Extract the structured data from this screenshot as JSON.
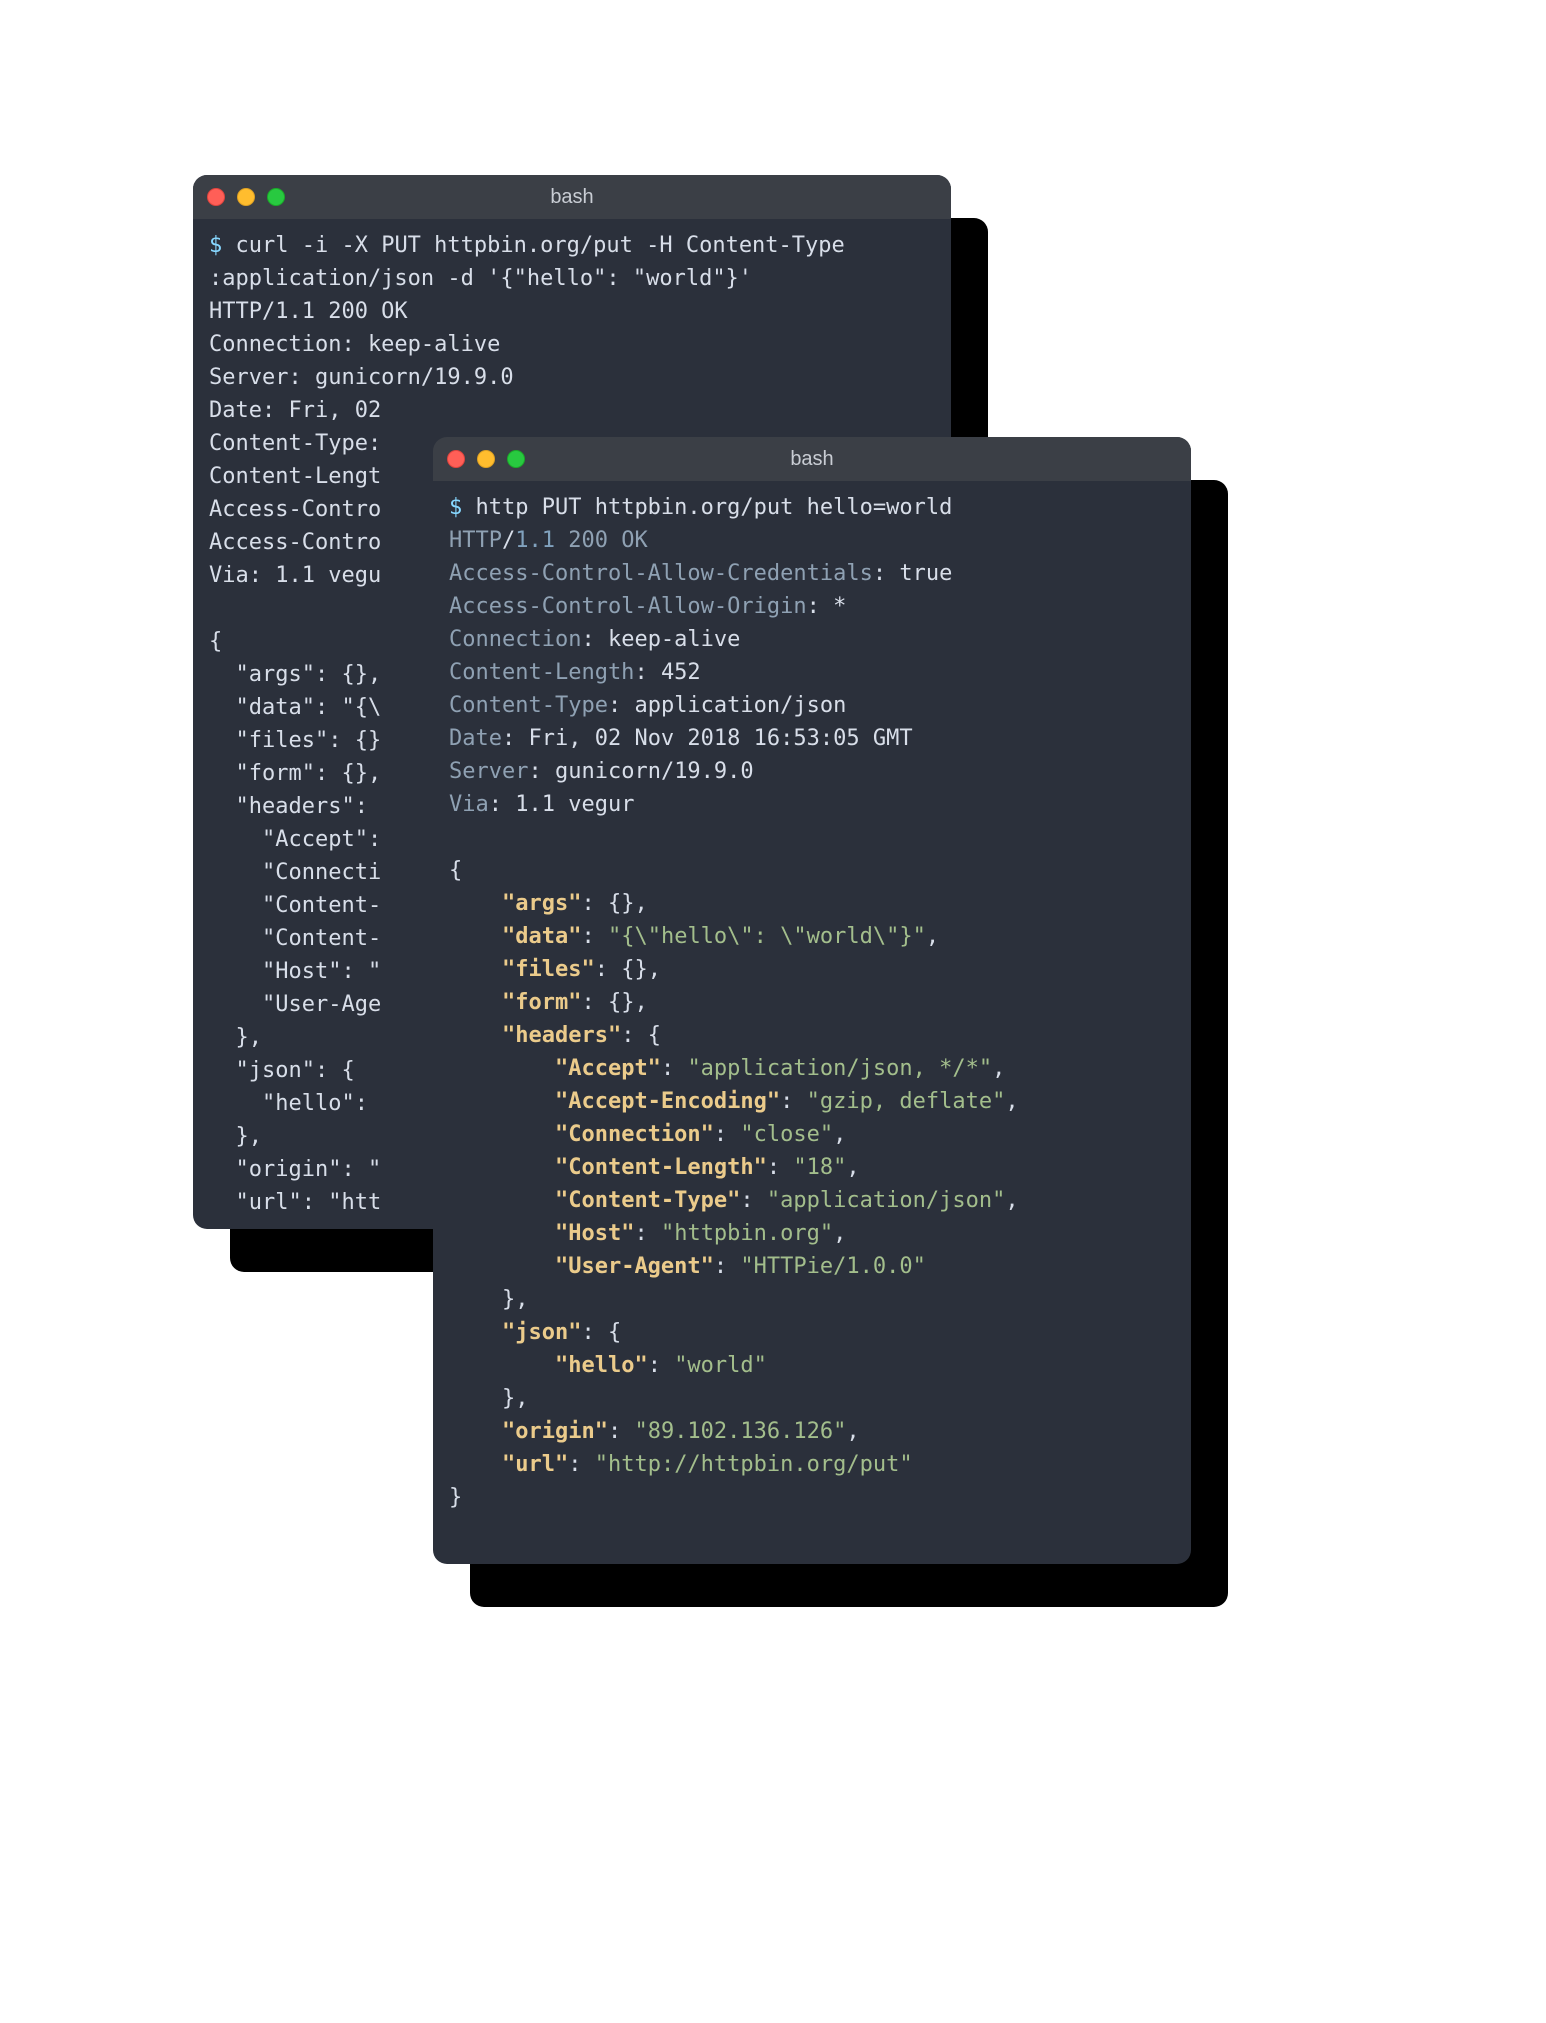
{
  "windows": {
    "back": {
      "title": "bash",
      "lines": [
        {
          "seg": [
            {
              "c": "prompt",
              "t": "$ "
            },
            {
              "c": "text",
              "t": "curl -i -X PUT httpbin.org/put -H Content-Type"
            }
          ]
        },
        {
          "seg": [
            {
              "c": "text",
              "t": ":application/json -d '{\"hello\": \"world\"}'"
            }
          ]
        },
        {
          "seg": [
            {
              "c": "text",
              "t": "HTTP/1.1 200 OK"
            }
          ]
        },
        {
          "seg": [
            {
              "c": "text",
              "t": "Connection: keep-alive"
            }
          ]
        },
        {
          "seg": [
            {
              "c": "text",
              "t": "Server: gunicorn/19.9.0"
            }
          ]
        },
        {
          "seg": [
            {
              "c": "text",
              "t": "Date: Fri, 02"
            }
          ]
        },
        {
          "seg": [
            {
              "c": "text",
              "t": "Content-Type:"
            }
          ]
        },
        {
          "seg": [
            {
              "c": "text",
              "t": "Content-Lengt"
            }
          ]
        },
        {
          "seg": [
            {
              "c": "text",
              "t": "Access-Contro"
            }
          ]
        },
        {
          "seg": [
            {
              "c": "text",
              "t": "Access-Contro"
            }
          ]
        },
        {
          "seg": [
            {
              "c": "text",
              "t": "Via: 1.1 vegu"
            }
          ]
        },
        {
          "seg": [
            {
              "c": "text",
              "t": ""
            }
          ]
        },
        {
          "seg": [
            {
              "c": "text",
              "t": "{"
            }
          ]
        },
        {
          "seg": [
            {
              "c": "text",
              "t": "  \"args\": {},"
            }
          ]
        },
        {
          "seg": [
            {
              "c": "text",
              "t": "  \"data\": \"{\\"
            }
          ]
        },
        {
          "seg": [
            {
              "c": "text",
              "t": "  \"files\": {}"
            }
          ]
        },
        {
          "seg": [
            {
              "c": "text",
              "t": "  \"form\": {},"
            }
          ]
        },
        {
          "seg": [
            {
              "c": "text",
              "t": "  \"headers\":"
            }
          ]
        },
        {
          "seg": [
            {
              "c": "text",
              "t": "    \"Accept\":"
            }
          ]
        },
        {
          "seg": [
            {
              "c": "text",
              "t": "    \"Connecti"
            }
          ]
        },
        {
          "seg": [
            {
              "c": "text",
              "t": "    \"Content-"
            }
          ]
        },
        {
          "seg": [
            {
              "c": "text",
              "t": "    \"Content-"
            }
          ]
        },
        {
          "seg": [
            {
              "c": "text",
              "t": "    \"Host\": \""
            }
          ]
        },
        {
          "seg": [
            {
              "c": "text",
              "t": "    \"User-Age"
            }
          ]
        },
        {
          "seg": [
            {
              "c": "text",
              "t": "  },"
            }
          ]
        },
        {
          "seg": [
            {
              "c": "text",
              "t": "  \"json\": {"
            }
          ]
        },
        {
          "seg": [
            {
              "c": "text",
              "t": "    \"hello\": "
            }
          ]
        },
        {
          "seg": [
            {
              "c": "text",
              "t": "  },"
            }
          ]
        },
        {
          "seg": [
            {
              "c": "text",
              "t": "  \"origin\": \""
            }
          ]
        },
        {
          "seg": [
            {
              "c": "text",
              "t": "  \"url\": \"htt"
            }
          ]
        }
      ]
    },
    "front": {
      "title": "bash",
      "lines": [
        {
          "seg": [
            {
              "c": "prompt",
              "t": "$ "
            },
            {
              "c": "text",
              "t": "http PUT httpbin.org/put hello=world"
            }
          ]
        },
        {
          "seg": [
            {
              "c": "hdr-name",
              "t": "HTTP"
            },
            {
              "c": "text",
              "t": "/"
            },
            {
              "c": "status-proto",
              "t": "1.1 "
            },
            {
              "c": "hdr-name",
              "t": "200 OK"
            }
          ]
        },
        {
          "seg": [
            {
              "c": "hdr-name",
              "t": "Access-Control-Allow-Credentials"
            },
            {
              "c": "text",
              "t": ": "
            },
            {
              "c": "text",
              "t": "true"
            }
          ]
        },
        {
          "seg": [
            {
              "c": "hdr-name",
              "t": "Access-Control-Allow-Origin"
            },
            {
              "c": "text",
              "t": ": "
            },
            {
              "c": "text",
              "t": "*"
            }
          ]
        },
        {
          "seg": [
            {
              "c": "hdr-name",
              "t": "Connection"
            },
            {
              "c": "text",
              "t": ": "
            },
            {
              "c": "text",
              "t": "keep-alive"
            }
          ]
        },
        {
          "seg": [
            {
              "c": "hdr-name",
              "t": "Content-Length"
            },
            {
              "c": "text",
              "t": ": "
            },
            {
              "c": "text",
              "t": "452"
            }
          ]
        },
        {
          "seg": [
            {
              "c": "hdr-name",
              "t": "Content-Type"
            },
            {
              "c": "text",
              "t": ": "
            },
            {
              "c": "text",
              "t": "application/json"
            }
          ]
        },
        {
          "seg": [
            {
              "c": "hdr-name",
              "t": "Date"
            },
            {
              "c": "text",
              "t": ": "
            },
            {
              "c": "text",
              "t": "Fri, 02 Nov 2018 16:53:05 GMT"
            }
          ]
        },
        {
          "seg": [
            {
              "c": "hdr-name",
              "t": "Server"
            },
            {
              "c": "text",
              "t": ": "
            },
            {
              "c": "text",
              "t": "gunicorn/19.9.0"
            }
          ]
        },
        {
          "seg": [
            {
              "c": "hdr-name",
              "t": "Via"
            },
            {
              "c": "text",
              "t": ": "
            },
            {
              "c": "text",
              "t": "1.1 vegur"
            }
          ]
        },
        {
          "seg": [
            {
              "c": "text",
              "t": ""
            }
          ]
        },
        {
          "seg": [
            {
              "c": "brace",
              "t": "{"
            }
          ]
        },
        {
          "seg": [
            {
              "c": "brace",
              "t": "    "
            },
            {
              "c": "key",
              "t": "\"args\""
            },
            {
              "c": "text",
              "t": ": "
            },
            {
              "c": "brace",
              "t": "{}"
            },
            {
              "c": "text",
              "t": ","
            }
          ]
        },
        {
          "seg": [
            {
              "c": "brace",
              "t": "    "
            },
            {
              "c": "key",
              "t": "\"data\""
            },
            {
              "c": "text",
              "t": ": "
            },
            {
              "c": "str",
              "t": "\"{\\\"hello\\\": \\\"world\\\"}\""
            },
            {
              "c": "text",
              "t": ","
            }
          ]
        },
        {
          "seg": [
            {
              "c": "brace",
              "t": "    "
            },
            {
              "c": "key",
              "t": "\"files\""
            },
            {
              "c": "text",
              "t": ": "
            },
            {
              "c": "brace",
              "t": "{}"
            },
            {
              "c": "text",
              "t": ","
            }
          ]
        },
        {
          "seg": [
            {
              "c": "brace",
              "t": "    "
            },
            {
              "c": "key",
              "t": "\"form\""
            },
            {
              "c": "text",
              "t": ": "
            },
            {
              "c": "brace",
              "t": "{}"
            },
            {
              "c": "text",
              "t": ","
            }
          ]
        },
        {
          "seg": [
            {
              "c": "brace",
              "t": "    "
            },
            {
              "c": "key",
              "t": "\"headers\""
            },
            {
              "c": "text",
              "t": ": "
            },
            {
              "c": "brace",
              "t": "{"
            }
          ]
        },
        {
          "seg": [
            {
              "c": "brace",
              "t": "        "
            },
            {
              "c": "key",
              "t": "\"Accept\""
            },
            {
              "c": "text",
              "t": ": "
            },
            {
              "c": "str",
              "t": "\"application/json, */*\""
            },
            {
              "c": "text",
              "t": ","
            }
          ]
        },
        {
          "seg": [
            {
              "c": "brace",
              "t": "        "
            },
            {
              "c": "key",
              "t": "\"Accept-Encoding\""
            },
            {
              "c": "text",
              "t": ": "
            },
            {
              "c": "str",
              "t": "\"gzip, deflate\""
            },
            {
              "c": "text",
              "t": ","
            }
          ]
        },
        {
          "seg": [
            {
              "c": "brace",
              "t": "        "
            },
            {
              "c": "key",
              "t": "\"Connection\""
            },
            {
              "c": "text",
              "t": ": "
            },
            {
              "c": "str",
              "t": "\"close\""
            },
            {
              "c": "text",
              "t": ","
            }
          ]
        },
        {
          "seg": [
            {
              "c": "brace",
              "t": "        "
            },
            {
              "c": "key",
              "t": "\"Content-Length\""
            },
            {
              "c": "text",
              "t": ": "
            },
            {
              "c": "str",
              "t": "\"18\""
            },
            {
              "c": "text",
              "t": ","
            }
          ]
        },
        {
          "seg": [
            {
              "c": "brace",
              "t": "        "
            },
            {
              "c": "key",
              "t": "\"Content-Type\""
            },
            {
              "c": "text",
              "t": ": "
            },
            {
              "c": "str",
              "t": "\"application/json\""
            },
            {
              "c": "text",
              "t": ","
            }
          ]
        },
        {
          "seg": [
            {
              "c": "brace",
              "t": "        "
            },
            {
              "c": "key",
              "t": "\"Host\""
            },
            {
              "c": "text",
              "t": ": "
            },
            {
              "c": "str",
              "t": "\"httpbin.org\""
            },
            {
              "c": "text",
              "t": ","
            }
          ]
        },
        {
          "seg": [
            {
              "c": "brace",
              "t": "        "
            },
            {
              "c": "key",
              "t": "\"User-Agent\""
            },
            {
              "c": "text",
              "t": ": "
            },
            {
              "c": "str",
              "t": "\"HTTPie/1.0.0\""
            }
          ]
        },
        {
          "seg": [
            {
              "c": "brace",
              "t": "    },"
            }
          ]
        },
        {
          "seg": [
            {
              "c": "brace",
              "t": "    "
            },
            {
              "c": "key",
              "t": "\"json\""
            },
            {
              "c": "text",
              "t": ": "
            },
            {
              "c": "brace",
              "t": "{"
            }
          ]
        },
        {
          "seg": [
            {
              "c": "brace",
              "t": "        "
            },
            {
              "c": "key",
              "t": "\"hello\""
            },
            {
              "c": "text",
              "t": ": "
            },
            {
              "c": "str",
              "t": "\"world\""
            }
          ]
        },
        {
          "seg": [
            {
              "c": "brace",
              "t": "    },"
            }
          ]
        },
        {
          "seg": [
            {
              "c": "brace",
              "t": "    "
            },
            {
              "c": "key",
              "t": "\"origin\""
            },
            {
              "c": "text",
              "t": ": "
            },
            {
              "c": "str",
              "t": "\"89.102.136.126\""
            },
            {
              "c": "text",
              "t": ","
            }
          ]
        },
        {
          "seg": [
            {
              "c": "brace",
              "t": "    "
            },
            {
              "c": "key",
              "t": "\"url\""
            },
            {
              "c": "text",
              "t": ": "
            },
            {
              "c": "str",
              "t": "\"http://httpbin.org/put\""
            }
          ]
        },
        {
          "seg": [
            {
              "c": "brace",
              "t": "}"
            }
          ]
        }
      ]
    }
  }
}
